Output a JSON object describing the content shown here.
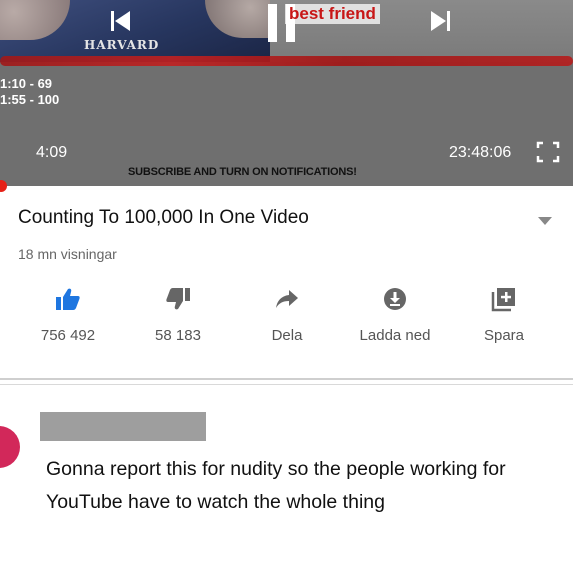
{
  "player": {
    "frame_text": "HARVARD",
    "overlay_text": "best friend",
    "counter_lines": [
      "1:10 - 69",
      "1:55 - 100"
    ],
    "current_time": "4:09",
    "duration": "23:48:06",
    "banner": "SUBSCRIBE AND TURN ON NOTIFICATIONS!",
    "progress_fraction": 0.003
  },
  "video": {
    "title": "Counting To 100,000 In One Video",
    "views": "18 mn visningar"
  },
  "actions": [
    {
      "icon": "thumbs-up-icon",
      "label": "756 492"
    },
    {
      "icon": "thumbs-down-icon",
      "label": "58 183"
    },
    {
      "icon": "share-icon",
      "label": "Dela"
    },
    {
      "icon": "download-icon",
      "label": "Ladda ned"
    },
    {
      "icon": "add-to-playlist-icon",
      "label": "Spara"
    }
  ],
  "comment": {
    "text": "Gonna report this for nudity so the people working for YouTube have to watch the whole thing"
  },
  "colors": {
    "accent": "#1a73e8",
    "brand_red": "#e62117",
    "avatar": "#d2285a"
  }
}
